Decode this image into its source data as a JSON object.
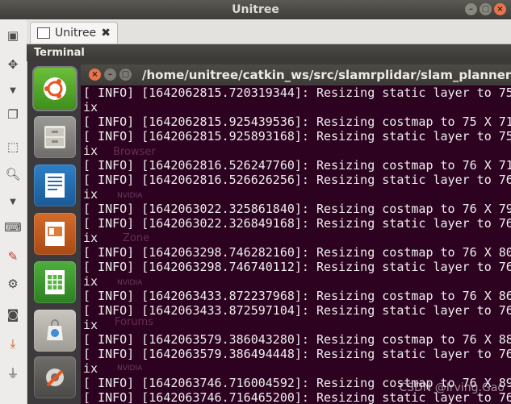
{
  "window": {
    "title": "Unitree"
  },
  "tabs": [
    {
      "label": "Unitree"
    }
  ],
  "panel": {
    "title": "Terminal"
  },
  "terminal": {
    "title": "/home/unitree/catkin_ws/src/slamrplidar/slam_planner/launch/s",
    "lines": [
      "[ INFO] [1642062815.720319344]: Resizing static layer to 75",
      "ix",
      "[ INFO] [1642062815.925439536]: Resizing costmap to 75 X 71",
      "[ INFO] [1642062815.925893168]: Resizing static layer to 75",
      "ix",
      "[ INFO] [1642062816.526247760]: Resizing costmap to 76 X 71",
      "[ INFO] [1642062816.526626256]: Resizing static layer to 76",
      "ix",
      "[ INFO] [1642063022.325861840]: Resizing costmap to 76 X 79",
      "[ INFO] [1642063022.326849168]: Resizing static layer to 76",
      "ix",
      "[ INFO] [1642063298.746282160]: Resizing costmap to 76 X 80",
      "[ INFO] [1642063298.746740112]: Resizing static layer to 76",
      "ix",
      "[ INFO] [1642063433.872237968]: Resizing costmap to 76 X 86",
      "[ INFO] [1642063433.872597104]: Resizing static layer to 76",
      "ix",
      "[ INFO] [1642063579.386043280]: Resizing costmap to 76 X 88",
      "[ INFO] [1642063579.386494448]: Resizing static layer to 76",
      "ix",
      "[ INFO] [1642063746.716004592]: Resizing costmap to 76 X 89",
      "[ INFO] [1642063746.716465200]: Resizing static layer to 76"
    ]
  },
  "background_labels": [
    "Browser",
    "NVIDIA",
    "Zone",
    "NVIDIA",
    "Forums",
    "NVIDIA"
  ],
  "watermark": "CSDN @Irving.Gao",
  "launcher_icons": [
    "ubuntu-logo-icon",
    "files-icon",
    "writer-icon",
    "impress-icon",
    "calc-icon",
    "software-center-icon",
    "settings-icon"
  ],
  "toolbar_icons": [
    "window-icon",
    "move-icon",
    "chevron-down-icon",
    "copy-icon",
    "screenshot-icon",
    "zoom-icon",
    "chevron-down-icon",
    "keyboard-icon",
    "tools-icon",
    "gears-icon",
    "camera-icon",
    "download-icon",
    "plug-icon"
  ],
  "colors": {
    "terminal_bg": "#2c0220",
    "terminal_text": "#eeeae4",
    "accent": "#e8744c"
  }
}
